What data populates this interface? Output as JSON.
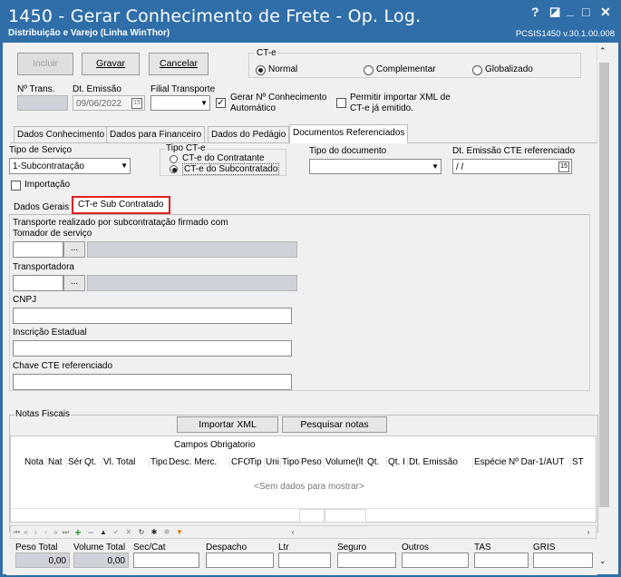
{
  "window": {
    "title": "1450 - Gerar Conhecimento de Frete - Op. Log.",
    "subtitle": "Distribuição e Varejo (Linha WinThor)",
    "version": "PCSIS1450  v.30.1.00.008",
    "help": "?",
    "restore": "◪",
    "minimize": "_",
    "maximize": "□",
    "close": "✕"
  },
  "toolbar": {
    "incluir": "Incluir",
    "gravar": "Gravar",
    "cancelar": "Cancelar"
  },
  "cte": {
    "legend": "CT-e",
    "normal": "Normal",
    "complementar": "Complementar",
    "globalizado": "Globalizado",
    "selected": "normal"
  },
  "header": {
    "ntrans_label": "Nº Trans.",
    "ntrans_value": "",
    "dtemissao_label": "Dt. Emissão",
    "dtemissao_value": "09/06/2022",
    "filial_label": "Filial Transporte",
    "filial_value": "",
    "gerar_label": "Gerar Nº Conhecimento Automático",
    "gerar_checked": true,
    "permitir_label": "Permitir importar XML de CT-e já emitido.",
    "permitir_checked": false
  },
  "tabs": [
    "Dados Conhecimento",
    "Dados para Financeiro",
    "Dados do Pedágio",
    "Documentos Referenciados"
  ],
  "active_tab": "Documentos Referenciados",
  "docref": {
    "tipo_servico_label": "Tipo de Serviço",
    "tipo_servico_value": "1-Subcontratação",
    "tipo_cte_label": "Tipo CT-e",
    "tipo_cte_contratante": "CT-e do Contratante",
    "tipo_cte_subcontratado": "CT-e do Subcontratado",
    "tipo_cte_selected": "subcontratado",
    "tipo_doc_label": "Tipo do documento",
    "tipo_doc_value": "",
    "dt_emissao_ref_label": "Dt. Emissão CTE referenciado",
    "dt_emissao_ref_value": " / /",
    "importacao_label": "Importação",
    "importacao_checked": false
  },
  "subtabs": [
    "Dados Gerais",
    "CT-e Sub Contratado"
  ],
  "active_subtab": "CT-e Sub Contratado",
  "subcontratado": {
    "desc": "Transporte realizado por subcontratação firmado com",
    "tomador_label": "Tomador de serviço",
    "tomador_code": "",
    "tomador_name": "",
    "transportadora_label": "Transportadora",
    "transportadora_code": "",
    "transportadora_name": "",
    "lookup": "...",
    "cnpj_label": "CNPJ",
    "cnpj_value": "",
    "ie_label": "Inscrição Estadual",
    "ie_value": "",
    "chave_label": "Chave CTE referenciado",
    "chave_value": ""
  },
  "notas": {
    "legend": "Notas Fiscais",
    "importar_xml": "Importar XML",
    "pesquisar": "Pesquisar notas",
    "group_header": "Campos Obrigatorio",
    "columns": [
      "Nota",
      "Nat",
      "Sér",
      "Qt.",
      "Vl. Total",
      "Tipo",
      "Desc. Merc.",
      "CFO",
      "Tip",
      "Uni",
      "Tipo",
      "Peso",
      "Volume(lt",
      "Qt.",
      "Qt. I",
      "Dt. Emissão",
      "Espécie",
      "Nº Dar-1/AUT",
      "ST"
    ],
    "empty": "<Sem dados para mostrar>"
  },
  "totals": {
    "peso_total_label": "Peso Total",
    "peso_total_value": "0,00",
    "volume_total_label": "Volume Total",
    "volume_total_value": "0,00",
    "sec_cat_label": "Sec/Cat",
    "despacho_label": "Despacho",
    "ltr_label": "Ltr",
    "seguro_label": "Seguro",
    "outros_label": "Outros",
    "tas_label": "TAS",
    "gris_label": "GRIS"
  },
  "colors": {
    "titlebar": "#2f6ea8",
    "highlight": "#e02020"
  }
}
